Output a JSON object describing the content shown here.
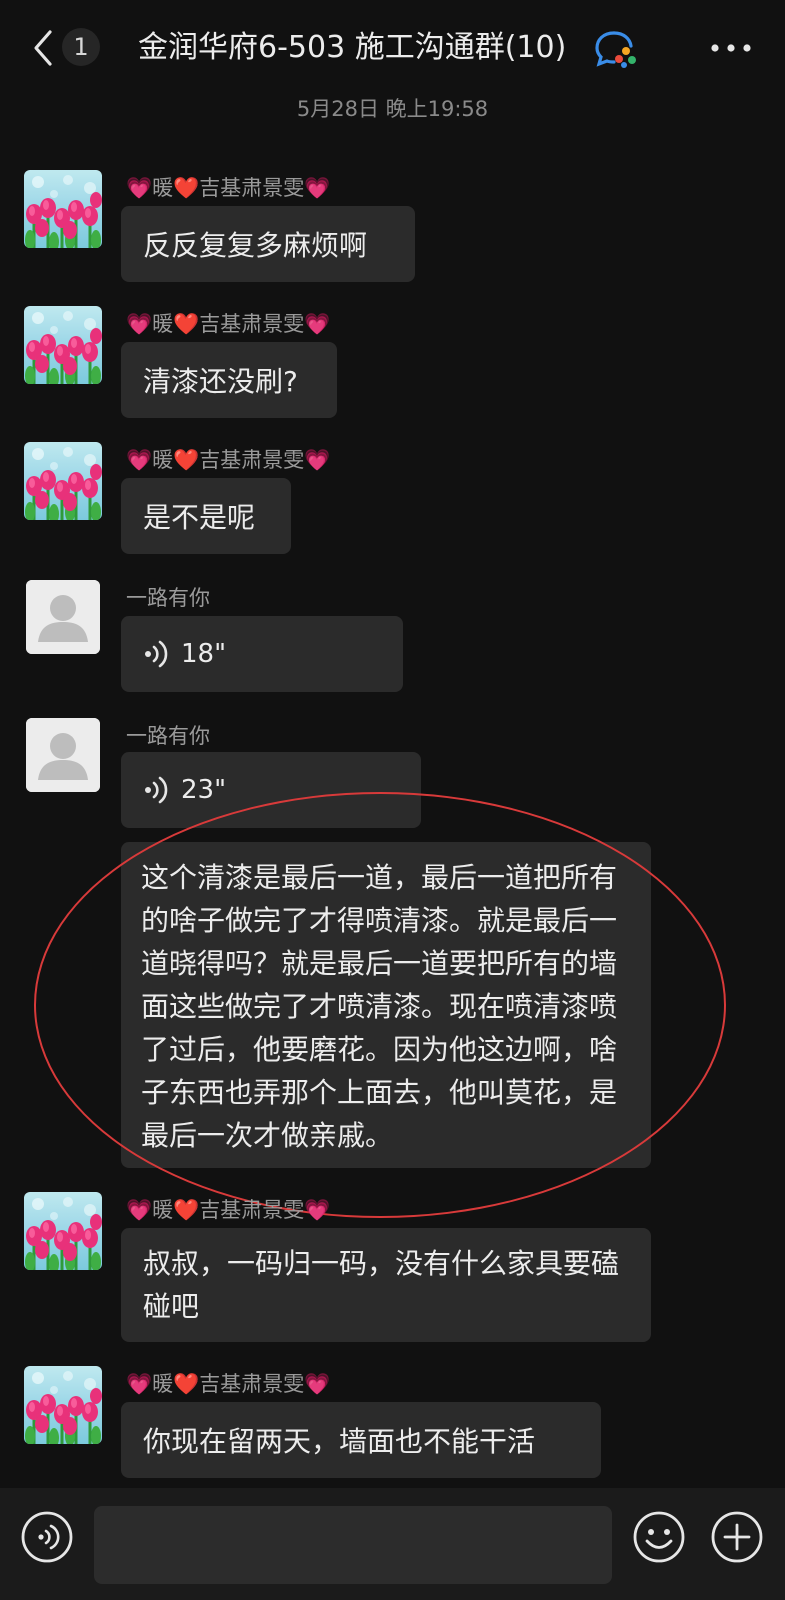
{
  "header": {
    "unread_count": "1",
    "title": "金润华府6-503  施工沟通群(10)"
  },
  "timestamp": "5月28日 晚上19:58",
  "messages": [
    {
      "sender": "💗暖❤️吉基肃景雯💗",
      "text": "反反复复多麻烦啊"
    },
    {
      "sender": "💗暖❤️吉基肃景雯💗",
      "text": "清漆还没刷?"
    },
    {
      "sender": "💗暖❤️吉基肃景雯💗",
      "text": "是不是呢"
    },
    {
      "sender": "一路有你",
      "voice_duration": "18\""
    },
    {
      "sender": "一路有你",
      "voice_duration": "23\"",
      "text": "这个清漆是最后一道，最后一道把所有的啥子做完了才得喷清漆。就是最后一道晓得吗？就是最后一道要把所有的墙面这些做完了才喷清漆。现在喷清漆喷了过后，他要磨花。因为他这边啊，啥子东西也弄那个上面去，他叫莫花，是最后一次才做亲戚。"
    },
    {
      "sender": "💗暖❤️吉基肃景雯💗",
      "text": "叔叔，一码归一码，没有什么家具要磕碰吧"
    },
    {
      "sender": "💗暖❤️吉基肃景雯💗",
      "text": "你现在留两天，墙面也不能干活"
    }
  ],
  "colors": {
    "background": "#111111",
    "bubble": "#2b2b2b",
    "annotation_ellipse": "#d83a3a"
  },
  "icons": [
    "back-chevron-icon",
    "group-chat-icon",
    "more-icon",
    "voice-wave-icon",
    "default-avatar-icon",
    "voice-input-icon",
    "emoji-icon",
    "add-icon"
  ]
}
